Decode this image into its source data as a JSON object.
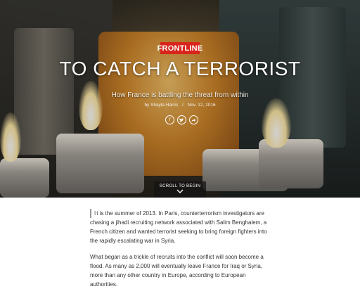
{
  "hero": {
    "badge": "FRONTLINE",
    "title": "TO CATCH A TERRORIST",
    "subtitle": "How France is battling the threat from within",
    "byline_author": "by Shayla Harris",
    "byline_separator": "/",
    "byline_date": "Nov. 12, 2016",
    "share_icons": [
      "facebook-icon",
      "twitter-icon",
      "share-icon"
    ],
    "scroll_label": "SCROLL TO BEGIN"
  },
  "article": {
    "drop_letter": "I",
    "paragraph1_rest": "t is the summer of 2013. In Paris, counterterrorism investigators are chasing a jihadi recruiting network associated with Salim Benghalem, a French citizen and wanted terrorist seeking to bring foreign fighters into the rapidly escalating war in Syria.",
    "paragraph2": "What began as a trickle of recruits into the conflict will soon become a flood. As many as 2,000 will eventually leave France for Iraq or Syria, more than any other country in Europe, according to European authorities."
  },
  "colors": {
    "brand_red": "#d9241c",
    "text": "#333333"
  }
}
